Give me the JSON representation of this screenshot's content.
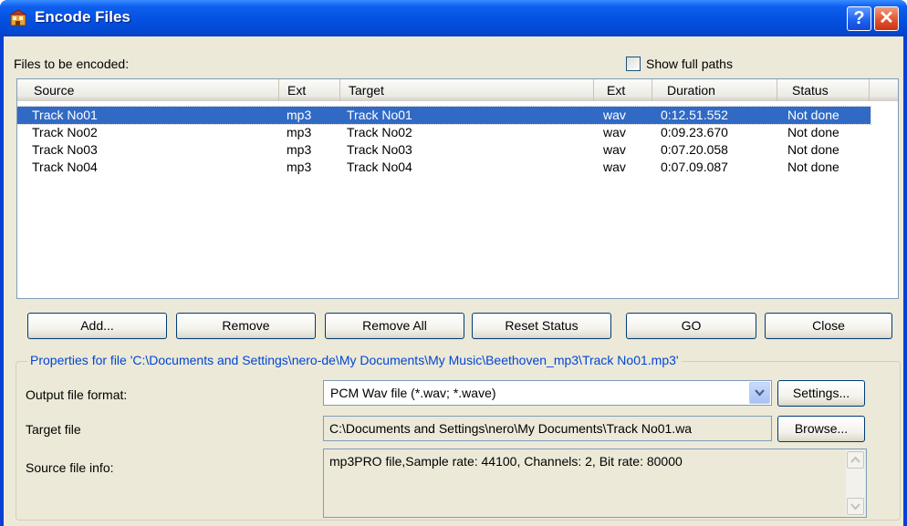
{
  "window": {
    "title": "Encode Files",
    "help_button": "?",
    "close_button": "✕"
  },
  "files_label": "Files to be encoded:",
  "show_full_paths": {
    "label": "Show full paths",
    "checked": false
  },
  "table": {
    "columns": [
      "Source",
      "Ext",
      "Target",
      "Ext",
      "Duration",
      "Status"
    ],
    "rows": [
      {
        "source": "Track No01",
        "src_ext": "mp3",
        "target": "Track No01",
        "tgt_ext": "wav",
        "duration": "0:12.51.552",
        "status": "Not done",
        "selected": true
      },
      {
        "source": "Track No02",
        "src_ext": "mp3",
        "target": "Track No02",
        "tgt_ext": "wav",
        "duration": "0:09.23.670",
        "status": "Not done",
        "selected": false
      },
      {
        "source": "Track No03",
        "src_ext": "mp3",
        "target": "Track No03",
        "tgt_ext": "wav",
        "duration": "0:07.20.058",
        "status": "Not done",
        "selected": false
      },
      {
        "source": "Track No04",
        "src_ext": "mp3",
        "target": "Track No04",
        "tgt_ext": "wav",
        "duration": "0:07.09.087",
        "status": "Not done",
        "selected": false
      }
    ]
  },
  "buttons": {
    "add": "Add...",
    "remove": "Remove",
    "remove_all": "Remove All",
    "reset_status": "Reset Status",
    "go": "GO",
    "close": "Close"
  },
  "properties": {
    "group_label": "Properties for file 'C:\\Documents and Settings\\nero-de\\My Documents\\My Music\\Beethoven_mp3\\Track No01.mp3'",
    "output_format_label": "Output file format:",
    "output_format_value": "PCM Wav file (*.wav; *.wave)",
    "settings_button": "Settings...",
    "target_label": "Target file",
    "target_value": "C:\\Documents and Settings\\nero\\My Documents\\Track No01.wa",
    "browse_button": "Browse...",
    "source_info_label": "Source file info:",
    "source_info_value": "mp3PRO file,Sample rate: 44100, Channels: 2, Bit rate: 80000"
  },
  "colors": {
    "titlebar": "#0453e2",
    "dialog_bg": "#ece9d8",
    "selection": "#316ac5",
    "group_label": "#0046d5"
  },
  "icons": [
    "app-icon",
    "help-icon",
    "close-icon",
    "chevron-down-icon",
    "scroll-up-icon",
    "scroll-down-icon",
    "checkbox"
  ]
}
